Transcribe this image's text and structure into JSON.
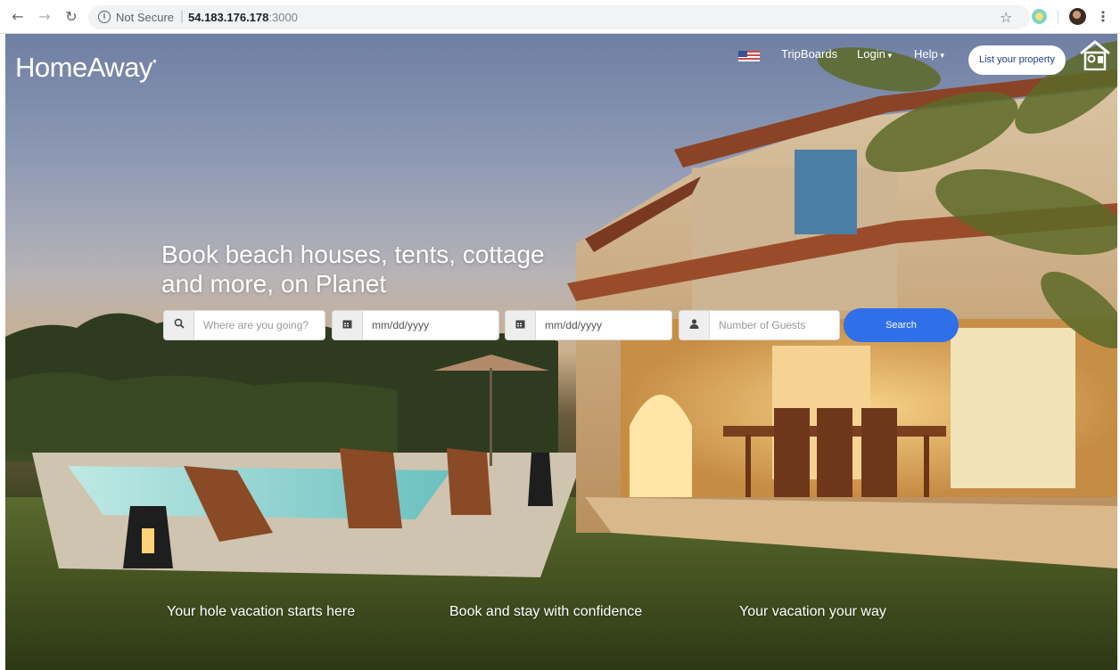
{
  "browser": {
    "security_label": "Not Secure",
    "url_host": "54.183.176.178",
    "url_port": ":3000"
  },
  "header": {
    "logo": "HomeAway",
    "nav": {
      "tripboards": "TripBoards",
      "login": "Login",
      "help": "Help"
    },
    "list_property": "List your property"
  },
  "hero": {
    "headline_line1": "Book beach houses, tents, cottage",
    "headline_line2": "and more, on Planet"
  },
  "search": {
    "where_placeholder": "Where are you going?",
    "checkin_placeholder": "mm/dd/yyyy",
    "checkout_placeholder": "mm/dd/yyyy",
    "guests_placeholder": "Number of Guests",
    "button": "Search"
  },
  "features": [
    "Your hole vacation starts here",
    "Book and stay with confidence",
    "Your vacation your way"
  ],
  "icons": {
    "back": "arrow-left-icon",
    "forward": "arrow-right-icon",
    "reload": "reload-icon",
    "info": "info-icon",
    "bookmark": "star-icon",
    "menu": "kebab-menu-icon",
    "flag": "us-flag-icon",
    "brand_mark": "birdhouse-icon",
    "where": "search-icon",
    "date": "calendar-icon",
    "guests": "user-icon"
  },
  "colors": {
    "search_button": "#2f6fe8",
    "list_button_text": "#23408e"
  }
}
